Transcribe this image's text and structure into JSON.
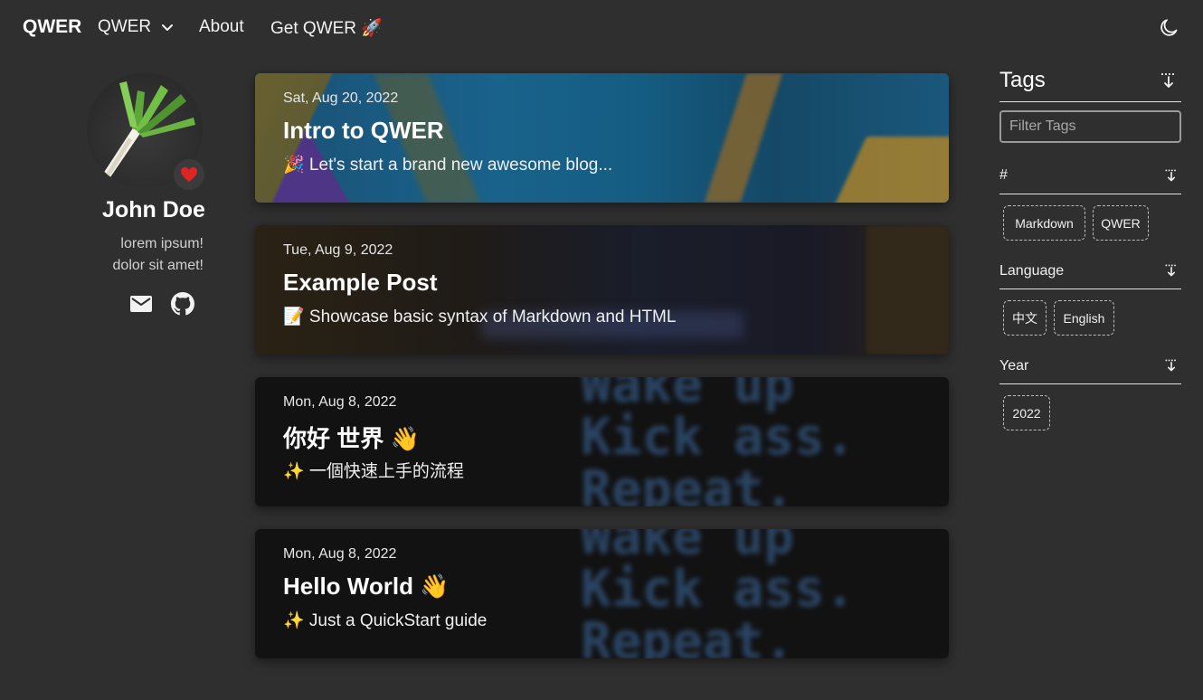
{
  "header": {
    "brand": "QWER",
    "nav": [
      {
        "label": "QWER"
      },
      {
        "label": "About"
      },
      {
        "label": "Get QWER 🚀"
      }
    ]
  },
  "profile": {
    "name": "John Doe",
    "bio_line1": "lorem ipsum!",
    "bio_line2": "dolor sit amet!"
  },
  "posts": [
    {
      "date": "Sat, Aug 20, 2022",
      "title": "Intro to QWER",
      "desc": "🎉 Let's start a brand new awesome blog..."
    },
    {
      "date": "Tue, Aug 9, 2022",
      "title": "Example Post",
      "desc": "📝 Showcase basic syntax of Markdown and HTML"
    },
    {
      "date": "Mon, Aug 8, 2022",
      "title": "你好 世界 👋",
      "desc": "✨ 一個快速上手的流程",
      "bg_text": "Wake up\nKick ass.\nRepeat."
    },
    {
      "date": "Mon, Aug 8, 2022",
      "title": "Hello World 👋",
      "desc": "✨ Just a QuickStart guide",
      "bg_text": "Wake up\nKick ass.\nRepeat."
    }
  ],
  "tags": {
    "title": "Tags",
    "filter_placeholder": "Filter Tags",
    "sections": [
      {
        "name": "#",
        "chips": [
          "Markdown",
          "QWER"
        ]
      },
      {
        "name": "Language",
        "chips": [
          "中文",
          "English"
        ]
      },
      {
        "name": "Year",
        "chips": [
          "2022"
        ]
      }
    ]
  },
  "colors": {
    "background": "#2f2f2f",
    "text": "#f2f2f2",
    "heart": "#e02424"
  }
}
